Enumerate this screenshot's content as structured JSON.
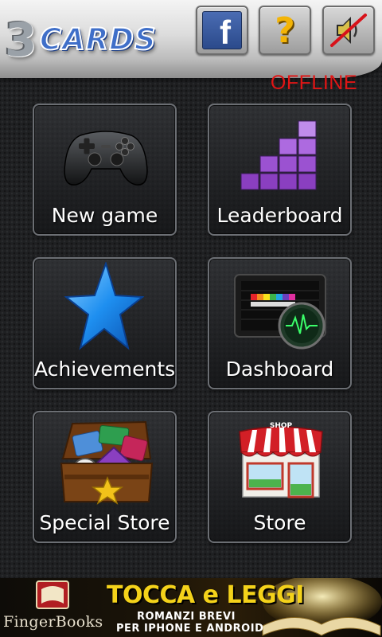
{
  "header": {
    "logo_number": "3",
    "logo_word": "CARDS",
    "buttons": {
      "facebook": {
        "icon": "facebook-icon",
        "glyph": "f"
      },
      "help": {
        "icon": "question-mark-icon",
        "glyph": "?"
      },
      "sound": {
        "icon": "speaker-muted-icon"
      }
    },
    "status": "OFFLINE"
  },
  "menu": {
    "items": [
      {
        "label": "New game",
        "icon": "gamepad-icon"
      },
      {
        "label": "Leaderboard",
        "icon": "bar-chart-icon"
      },
      {
        "label": "Achievements",
        "icon": "star-icon"
      },
      {
        "label": "Dashboard",
        "icon": "dashboard-monitor-icon"
      },
      {
        "label": "Special Store",
        "icon": "treasure-chest-icon"
      },
      {
        "label": "Store",
        "icon": "shop-icon",
        "sign": "SHOP"
      }
    ]
  },
  "ad": {
    "brand": "FingerBooks",
    "title": "TOCCA e LEGGI",
    "subtitle_line1": "ROMANZI BREVI",
    "subtitle_line2": "PER IPHONE E ANDROID"
  },
  "colors": {
    "status_red": "#e01515",
    "star_blue": "#1e8ff0",
    "leaderboard_purple": "#8a3fc0",
    "ad_title_yellow": "#f4d21a"
  }
}
